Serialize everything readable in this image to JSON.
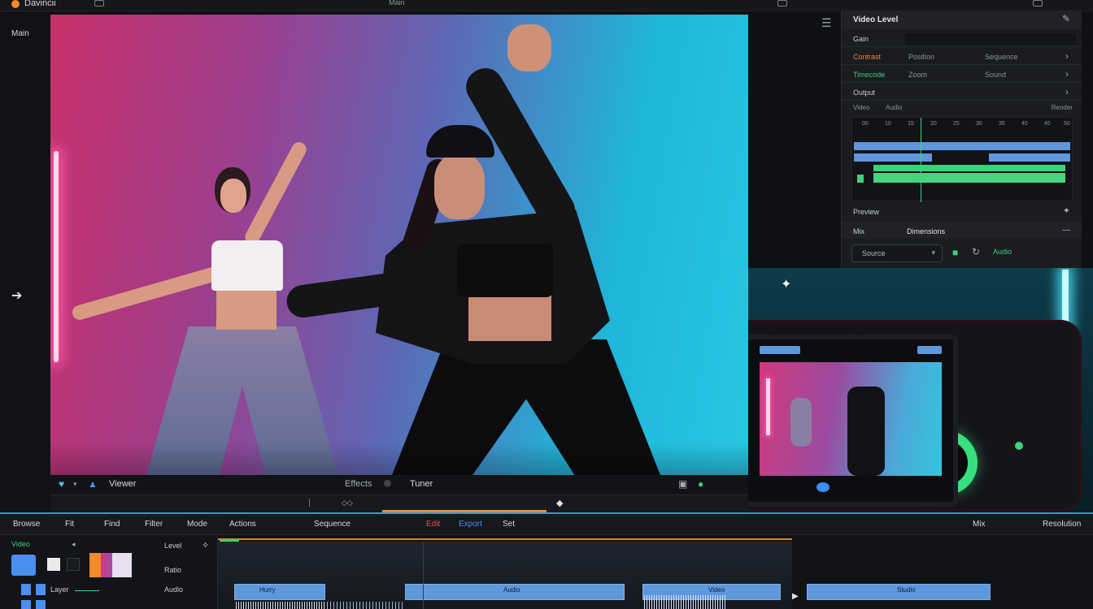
{
  "app": {
    "title": "Davincii",
    "top_center": "Main"
  },
  "left": {
    "label": "Main"
  },
  "right_panel": {
    "title": "Video Level",
    "rows": [
      {
        "label": "Gain",
        "v1": "",
        "v2": "",
        "color": "#c9ccd3"
      },
      {
        "label": "Contrast",
        "v1": "Position",
        "v2": "Sequence",
        "color": "#f08a2b"
      },
      {
        "label": "Timecode",
        "v1": "Zoom",
        "v2": "Sound",
        "color": "#3fd07a"
      },
      {
        "label": "Output",
        "v1": "",
        "v2": "",
        "color": "#c9ccd3"
      }
    ],
    "mini_labels": [
      "Video",
      "Audio",
      "Render"
    ],
    "mini_ticks": [
      "00",
      "10",
      "15",
      "20",
      "25",
      "30",
      "35",
      "40",
      "45",
      "50"
    ],
    "sub1": "Preview",
    "sub2_left": "Mix",
    "sub2_mid": "Dimensions",
    "select": "Source",
    "icons": [
      "record-icon",
      "refresh-icon",
      "waveform-icon"
    ],
    "wave_label": "Audio"
  },
  "viewer": {
    "label": "Viewer",
    "center_left": "Effects",
    "center_right": "Tuner"
  },
  "timeline": {
    "headers": [
      "Browse",
      "Fit",
      "Find",
      "Filter",
      "Mode",
      "Actions",
      "Sequence",
      "Edit",
      "Export",
      "Set",
      "Mix",
      "Resolution"
    ],
    "left_rows": [
      "Video",
      "Layer",
      "Audio",
      "Ratio",
      "Level"
    ],
    "clip_labels": [
      "Hurry",
      "Audio",
      "Video",
      "Studio"
    ]
  },
  "colors": {
    "accent": "#f08a2b",
    "green": "#3fd07a",
    "teal": "#26a3b8",
    "clip": "#5f97dc"
  }
}
